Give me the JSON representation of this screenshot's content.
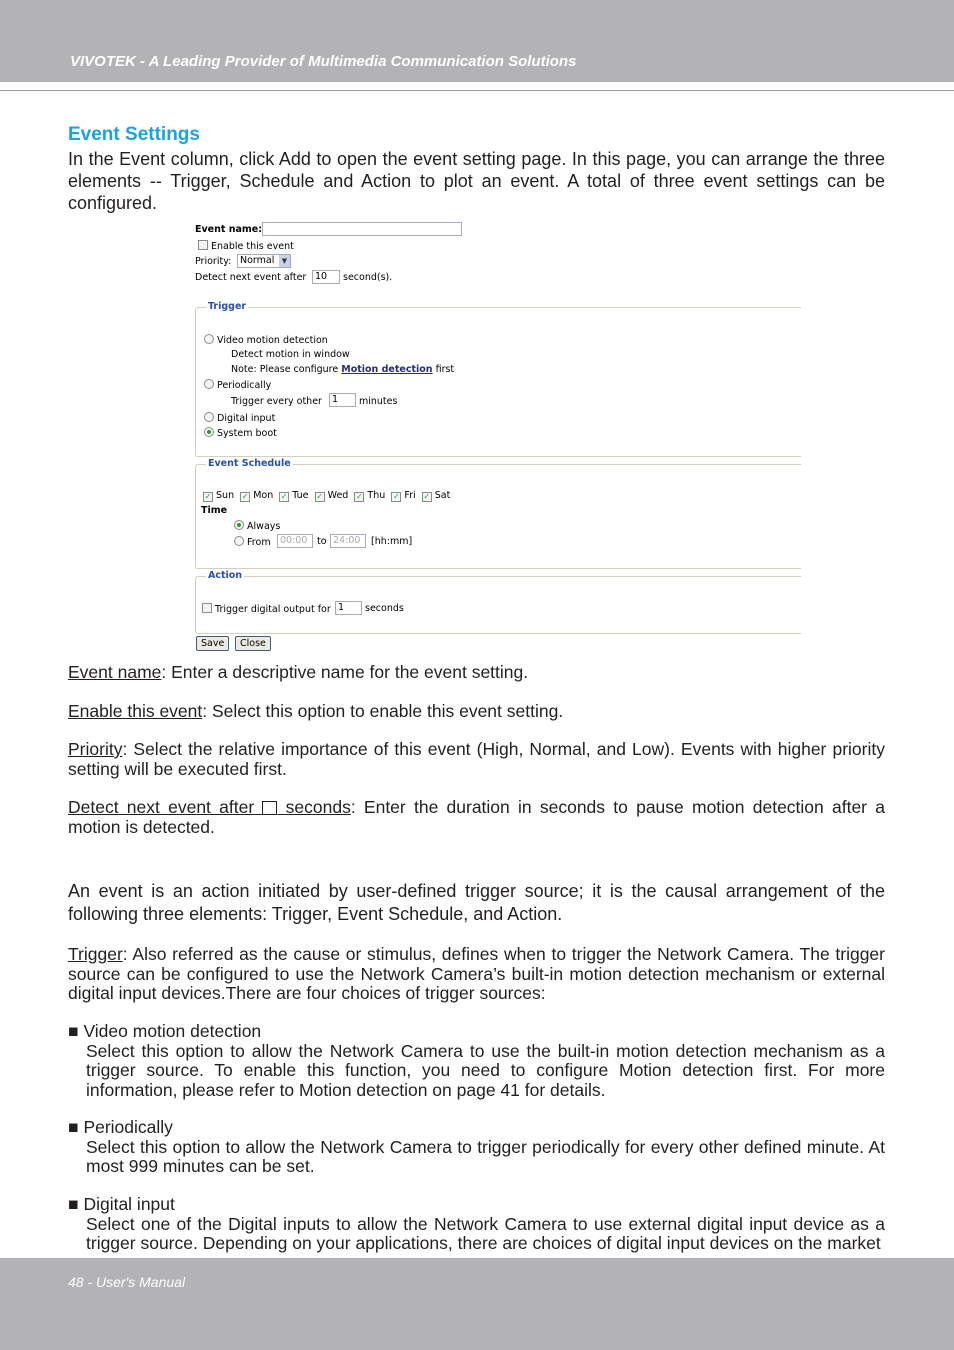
{
  "header": {
    "text": "VIVOTEK - A Leading Provider of Multimedia Communication Solutions"
  },
  "footer": {
    "text": "48 - User's Manual"
  },
  "section_title": "Event Settings",
  "intro": "In the Event column, click Add to open the event setting page. In this page, you can arrange the three elements -- Trigger, Schedule and Action to plot an event. A total of three event settings can be configured.",
  "screenshot": {
    "event_name_label": "Event name:",
    "event_name_value": "",
    "enable_label": "Enable this event",
    "enable_checked": false,
    "priority_label": "Priority:",
    "priority_value": "Normal",
    "detect_label": "Detect next event after",
    "detect_value": "10",
    "detect_unit": "second(s).",
    "trigger": {
      "legend": "Trigger",
      "vmd": "Video motion detection",
      "vmd_sub": "Detect motion in window",
      "note_pre": "Note: Please configure",
      "note_link": "Motion detection",
      "note_post": "first",
      "periodic": "Periodically",
      "periodic_pre": "Trigger every other",
      "periodic_value": "1",
      "periodic_unit": "minutes",
      "digital": "Digital input",
      "boot": "System boot",
      "selected": "System boot"
    },
    "schedule": {
      "legend": "Event Schedule",
      "days": [
        "Sun",
        "Mon",
        "Tue",
        "Wed",
        "Thu",
        "Fri",
        "Sat"
      ],
      "time_label": "Time",
      "always": "Always",
      "from": "From",
      "from_value": "00:00",
      "to": "to",
      "to_value": "24:00",
      "format": "[hh:mm]",
      "selected": "Always"
    },
    "action": {
      "legend": "Action",
      "label": "Trigger digital output for",
      "value": "1",
      "unit": "seconds",
      "checked": false
    },
    "save": "Save",
    "close": "Close"
  },
  "defs": {
    "event_name_term": "Event name",
    "event_name_text": ": Enter a descriptive name for the event setting.",
    "enable_term": "Enable this event",
    "enable_text": ": Select this option to enable this event setting.",
    "priority_term": "Priority",
    "priority_text": ": Select the relative importance of this event (High, Normal, and Low). Events with higher priority setting will be executed first.",
    "detect_term_a": "Detect next event after",
    "detect_term_b": "seconds",
    "detect_text": ": Enter the duration in seconds to pause motion detection after a motion is detected."
  },
  "event_para": "An event is an action initiated by user-defined trigger source; it is the causal arrangement of the following three elements: Trigger, Event Schedule, and Action.",
  "trigger_term": "Trigger",
  "trigger_text": ": Also referred as the cause or stimulus, defines when to trigger the Network Camera. The trigger source can be configured to use the Network Camera’s built-in motion detection mechanism or external digital input devices.There are four choices of trigger sources:",
  "bullets": [
    {
      "title": "Video motion detection",
      "text": "Select this option to allow the Network Camera to use the built-in motion detection mechanism as a trigger source. To enable this function, you need to configure Motion detection first. For more information, please refer to Motion detection on page 41 for details."
    },
    {
      "title": "Periodically",
      "text": "Select this option to allow the Network Camera to trigger periodically for every other defined minute. At most 999 minutes can be set."
    },
    {
      "title": "Digital input",
      "text": "Select one of the Digital inputs to allow the Network Camera to use external digital input device as a trigger source. Depending on your applications, there are choices of digital input devices on the market"
    }
  ]
}
